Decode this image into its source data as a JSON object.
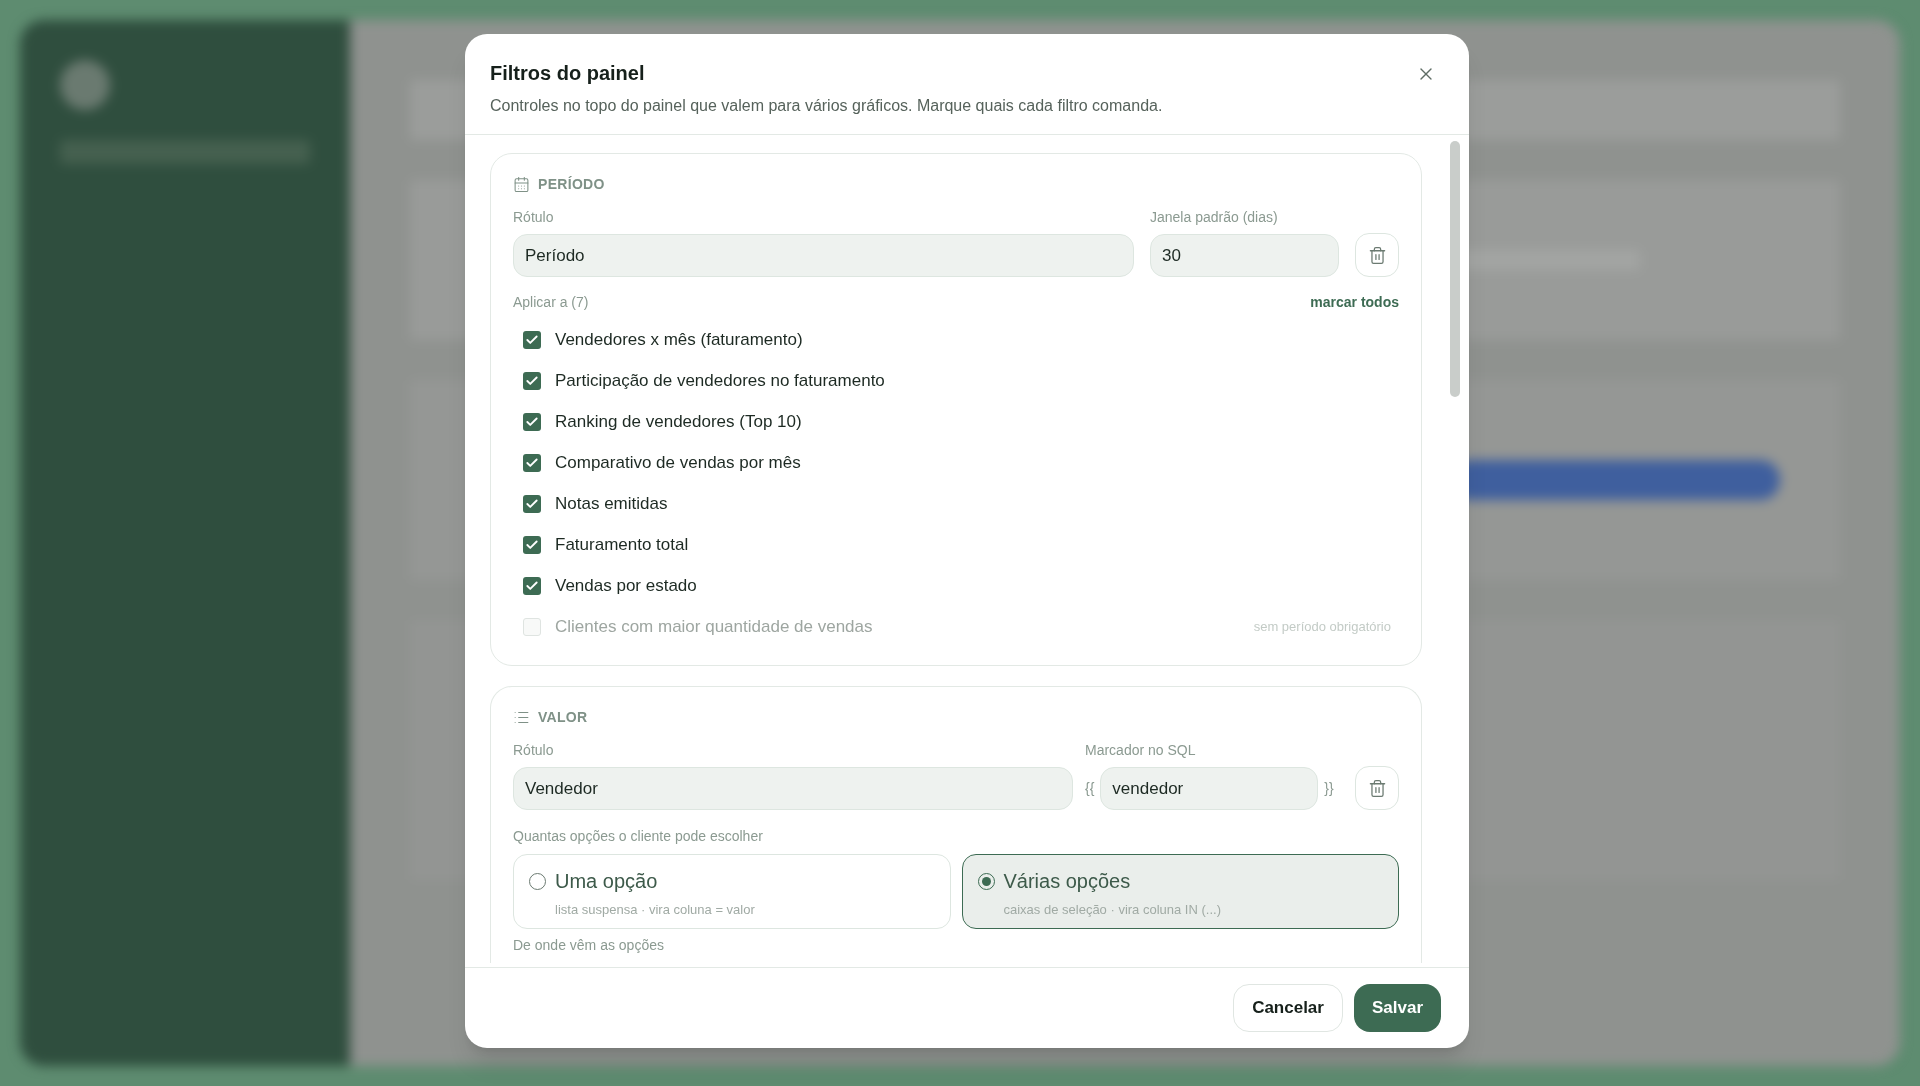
{
  "dialog": {
    "title": "Filtros do painel",
    "subtitle": "Controles no topo do painel que valem para vários gráficos. Marque quais cada filtro comanda.",
    "filters": [
      {
        "kind": "period",
        "heading": "PERÍODO",
        "label_caption": "Rótulo",
        "label_value": "Período",
        "window_caption": "Janela padrão (dias)",
        "window_value": "30",
        "apply_caption": "Aplicar a (7)",
        "select_all": "marcar todos",
        "charts": [
          {
            "name": "Vendedores x mês (faturamento)",
            "checked": true,
            "disabled": false
          },
          {
            "name": "Participação de vendedores no faturamento",
            "checked": true,
            "disabled": false
          },
          {
            "name": "Ranking de vendedores (Top 10)",
            "checked": true,
            "disabled": false
          },
          {
            "name": "Comparativo de vendas por mês",
            "checked": true,
            "disabled": false
          },
          {
            "name": "Notas emitidas",
            "checked": true,
            "disabled": false
          },
          {
            "name": "Faturamento total",
            "checked": true,
            "disabled": false
          },
          {
            "name": "Vendas por estado",
            "checked": true,
            "disabled": false
          },
          {
            "name": "Clientes com maior quantidade de vendas",
            "checked": false,
            "disabled": true,
            "note": "sem período obrigatório"
          }
        ]
      },
      {
        "kind": "value",
        "heading": "VALOR",
        "label_caption": "Rótulo",
        "label_value": "Vendedor",
        "marker_caption": "Marcador no SQL",
        "marker_open": "{{",
        "marker_value": "vendedor",
        "marker_close": "}}",
        "choice_caption": "Quantas opções o cliente pode escolher",
        "choices": [
          {
            "title": "Uma opção",
            "hint": "lista suspensa · vira coluna = valor",
            "selected": false
          },
          {
            "title": "Várias opções",
            "hint": "caixas de seleção · vira coluna IN (...)",
            "selected": true
          }
        ],
        "source_caption": "De onde vêm as opções"
      }
    ],
    "buttons": [
      {
        "label": "Cancelar",
        "kind": "secondary"
      },
      {
        "label": "Salvar",
        "kind": "primary"
      }
    ]
  }
}
